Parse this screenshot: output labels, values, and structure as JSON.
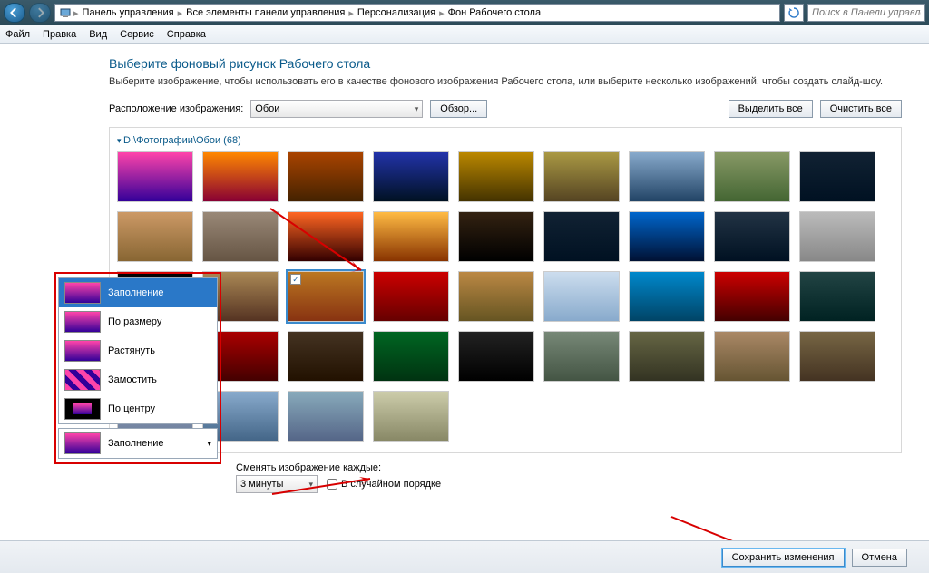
{
  "nav": {
    "breadcrumb": [
      "Панель управления",
      "Все элементы панели управления",
      "Персонализация",
      "Фон Рабочего стола"
    ],
    "search_placeholder": "Поиск в Панели управлен"
  },
  "menu": [
    "Файл",
    "Правка",
    "Вид",
    "Сервис",
    "Справка"
  ],
  "page": {
    "title": "Выберите фоновый рисунок Рабочего стола",
    "subtitle": "Выберите изображение, чтобы использовать его в качестве фонового изображения Рабочего стола, или выберите несколько изображений, чтобы создать слайд-шоу.",
    "location_label": "Расположение изображения:",
    "location_value": "Обои",
    "browse": "Обзор...",
    "select_all": "Выделить все",
    "clear_all": "Очистить все"
  },
  "gallery": {
    "group_title": "D:\\Фотографии\\Обои (68)",
    "selected_index": 20
  },
  "position_popup": {
    "items": [
      "Заполнение",
      "По размеру",
      "Растянуть",
      "Замостить",
      "По центру"
    ],
    "current": "Заполнение"
  },
  "change": {
    "label": "Сменять изображение каждые:",
    "interval": "3 минуты",
    "shuffle": "В случайном порядке"
  },
  "footer": {
    "save": "Сохранить изменения",
    "cancel": "Отмена"
  }
}
